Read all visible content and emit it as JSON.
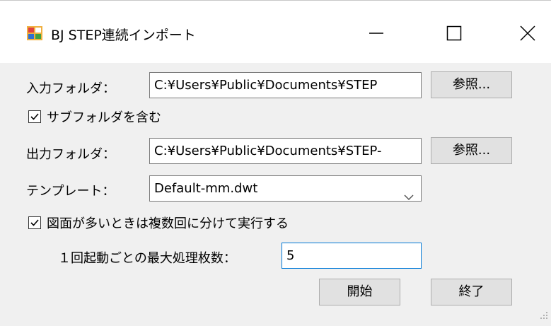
{
  "window": {
    "title": "BJ STEP連続インポート"
  },
  "form": {
    "input_label": "入力フォルダ：",
    "input_value": "C:¥Users¥Public¥Documents¥STEP",
    "browse_label": "参照...",
    "subfolder_label": "サブフォルダを含む",
    "subfolder_checked": true,
    "output_label": "出力フォルダ：",
    "output_value": "C:¥Users¥Public¥Documents¥STEP-",
    "template_label": "テンプレート：",
    "template_value": "Default-mm.dwt",
    "split_label": "図面が多いときは複数回に分けて実行する",
    "split_checked": true,
    "max_label": "１回起動ごとの最大処理枚数：",
    "max_value": "5",
    "start_label": "開始",
    "exit_label": "終了"
  },
  "icons": {
    "app": "app-icon",
    "minimize": "minimize-icon",
    "maximize": "maximize-icon",
    "close": "close-icon",
    "dropdown": "chevron-down-icon"
  },
  "colors": {
    "focus_border": "#0078d7",
    "button_face": "#e1e1e1",
    "window_bg": "#f0f0f0"
  }
}
